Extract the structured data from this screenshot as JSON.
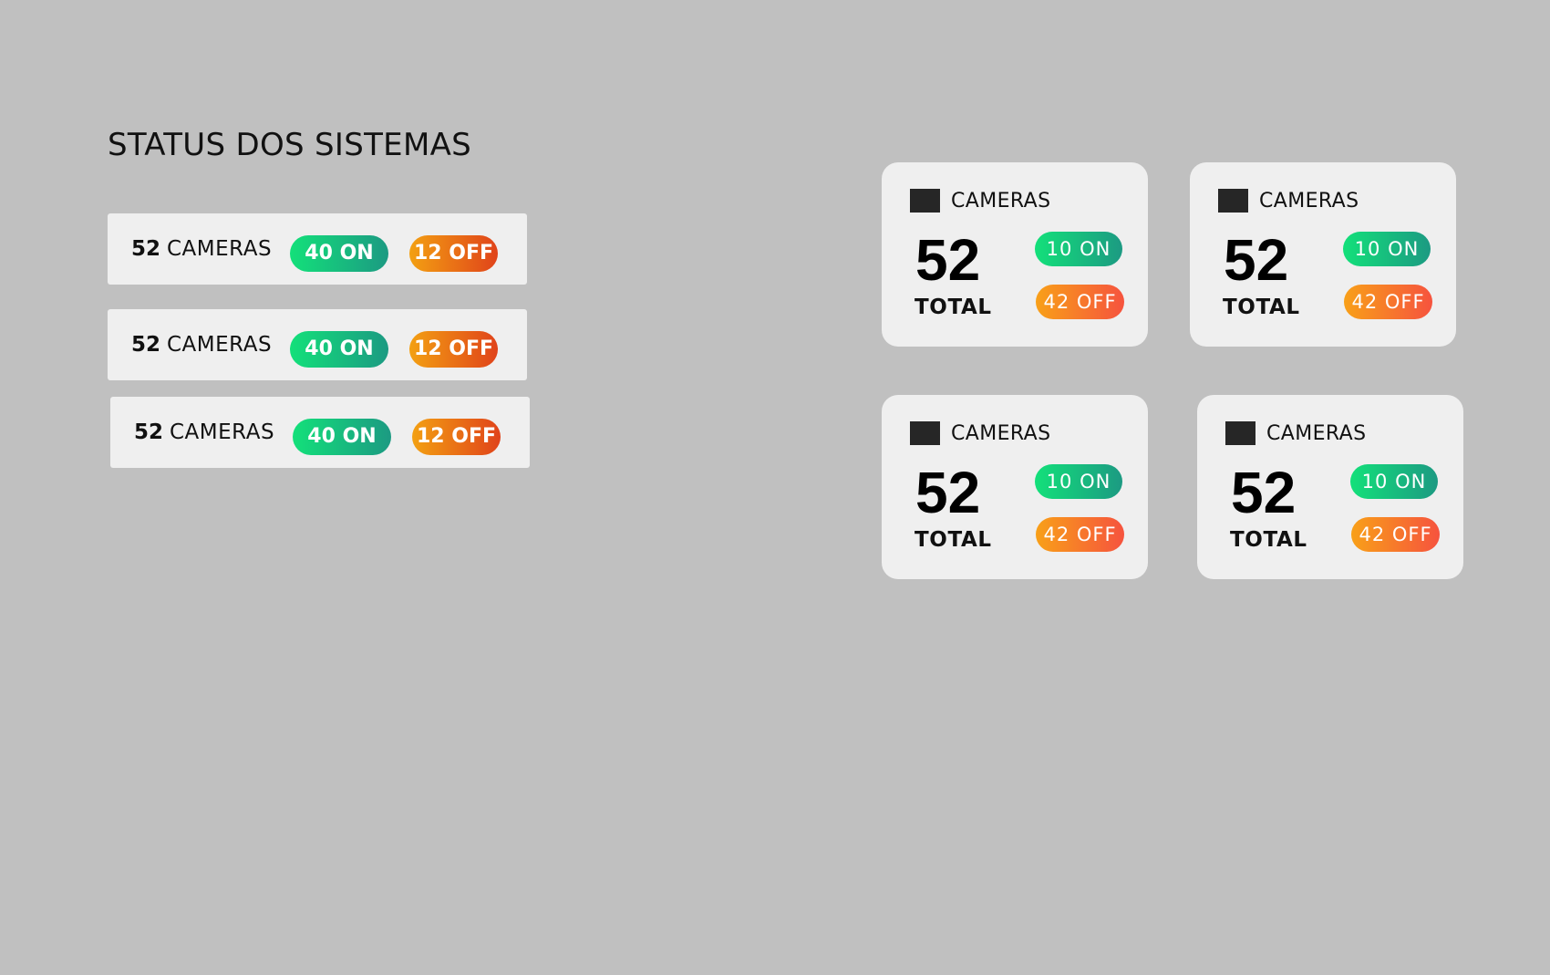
{
  "page": {
    "title": "STATUS DOS SISTEMAS"
  },
  "rows": [
    {
      "total": "52",
      "label": "CAMERAS",
      "on": "40 ON",
      "off": "12 OFF"
    },
    {
      "total": "52",
      "label": "CAMERAS",
      "on": "40 ON",
      "off": "12 OFF"
    },
    {
      "total": "52",
      "label": "CAMERAS",
      "on": "40 ON",
      "off": "12 OFF"
    }
  ],
  "cards": [
    {
      "label": "CAMERAS",
      "total": "52",
      "total_label": "TOTAL",
      "on": "10 ON",
      "off": "42 OFF",
      "icon": "camera-icon"
    },
    {
      "label": "CAMERAS",
      "total": "52",
      "total_label": "TOTAL",
      "on": "10 ON",
      "off": "42 OFF",
      "icon": "camera-icon"
    },
    {
      "label": "CAMERAS",
      "total": "52",
      "total_label": "TOTAL",
      "on": "10 ON",
      "off": "42 OFF",
      "icon": "camera-icon"
    },
    {
      "label": "CAMERAS",
      "total": "52",
      "total_label": "TOTAL",
      "on": "10 ON",
      "off": "42 OFF",
      "icon": "camera-icon"
    }
  ],
  "colors": {
    "background": "#c0c0c0",
    "panel": "#efefef",
    "on_start": "#13e07a",
    "on_end": "#1c9a82",
    "off_start": "#f3a012",
    "off_end": "#e0431a"
  }
}
